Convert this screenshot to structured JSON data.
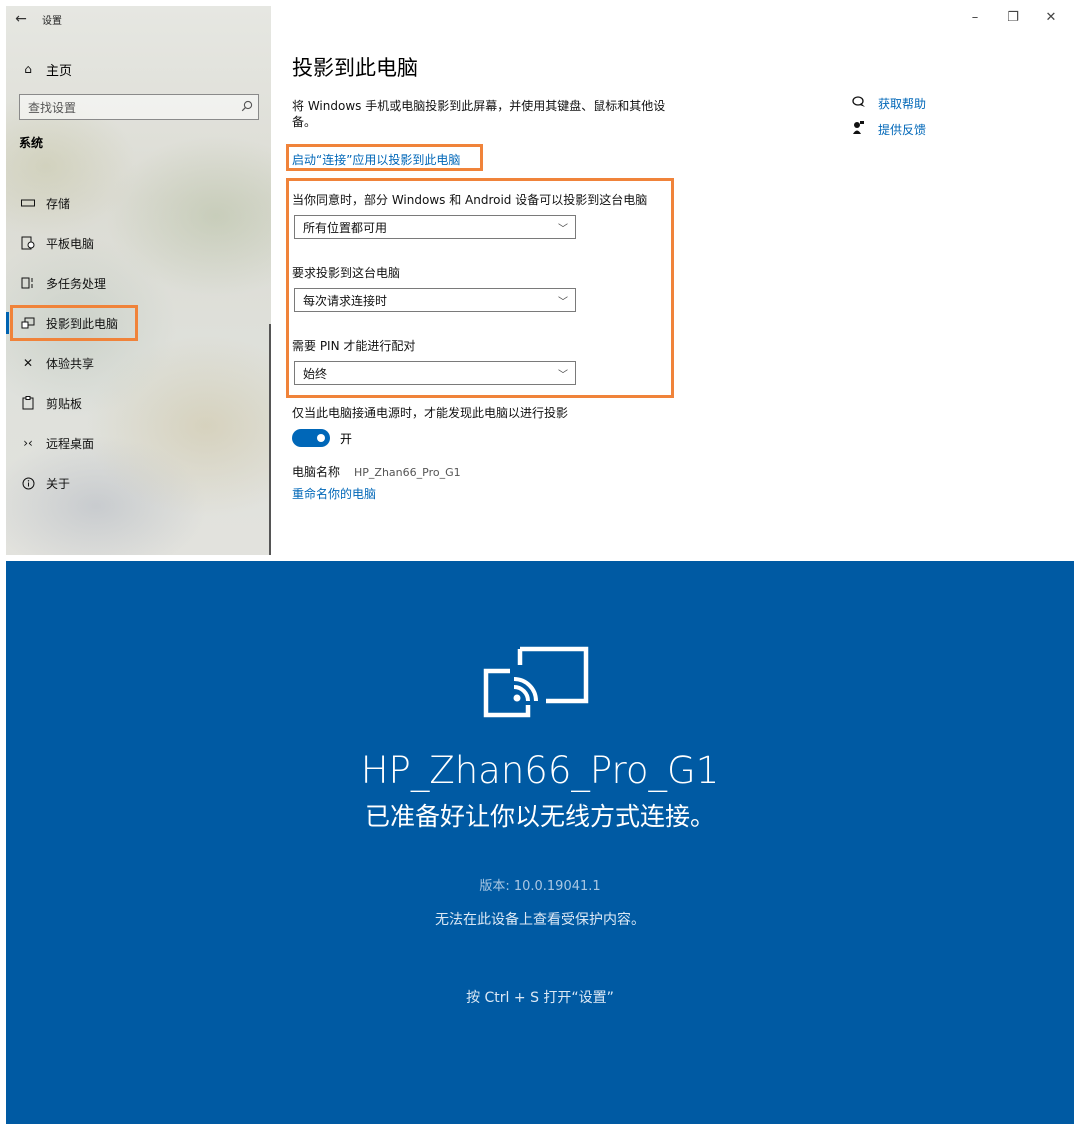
{
  "window": {
    "title": "设置",
    "controls": {
      "minimize": "–",
      "restore": "❐",
      "close": "✕"
    }
  },
  "sidebar": {
    "home_label": "主页",
    "search_placeholder": "查找设置",
    "section_title": "系统",
    "items": [
      {
        "label": "存储",
        "icon": "storage-icon"
      },
      {
        "label": "平板电脑",
        "icon": "tablet-icon"
      },
      {
        "label": "多任务处理",
        "icon": "multitask-icon"
      },
      {
        "label": "投影到此电脑",
        "icon": "projection-icon",
        "selected": true
      },
      {
        "label": "体验共享",
        "icon": "shared-experiences-icon"
      },
      {
        "label": "剪贴板",
        "icon": "clipboard-icon"
      },
      {
        "label": "远程桌面",
        "icon": "remote-desktop-icon"
      },
      {
        "label": "关于",
        "icon": "info-icon"
      }
    ]
  },
  "main": {
    "title": "投影到此电脑",
    "description": "将 Windows 手机或电脑投影到此屏幕，并使用其键盘、鼠标和其他设备。",
    "connect_link": "启动“连接”应用以投影到此电脑",
    "settings": [
      {
        "label": "当你同意时，部分 Windows 和 Android 设备可以投影到这台电脑",
        "value": "所有位置都可用"
      },
      {
        "label": "要求投影到这台电脑",
        "value": "每次请求连接时"
      },
      {
        "label": "需要 PIN 才能进行配对",
        "value": "始终"
      }
    ],
    "power_label": "仅当此电脑接通电源时，才能发现此电脑以进行投影",
    "toggle_state": "开",
    "pc_name_label": "电脑名称",
    "pc_name_value": "HP_Zhan66_Pro_G1",
    "rename_link": "重命名你的电脑",
    "help_link": "获取帮助",
    "feedback_link": "提供反馈"
  },
  "connect_screen": {
    "device_name": "HP_Zhan66_Pro_G1",
    "ready_text": "已准备好让你以无线方式连接。",
    "version_text": "版本: 10.0.19041.1",
    "protected_text": "无法在此设备上查看受保护内容。",
    "shortcut_text": "按 Ctrl + S 打开“设置”"
  },
  "colors": {
    "accent": "#0067b8",
    "highlight": "#f0833a",
    "connect_background": "#005aa3"
  }
}
